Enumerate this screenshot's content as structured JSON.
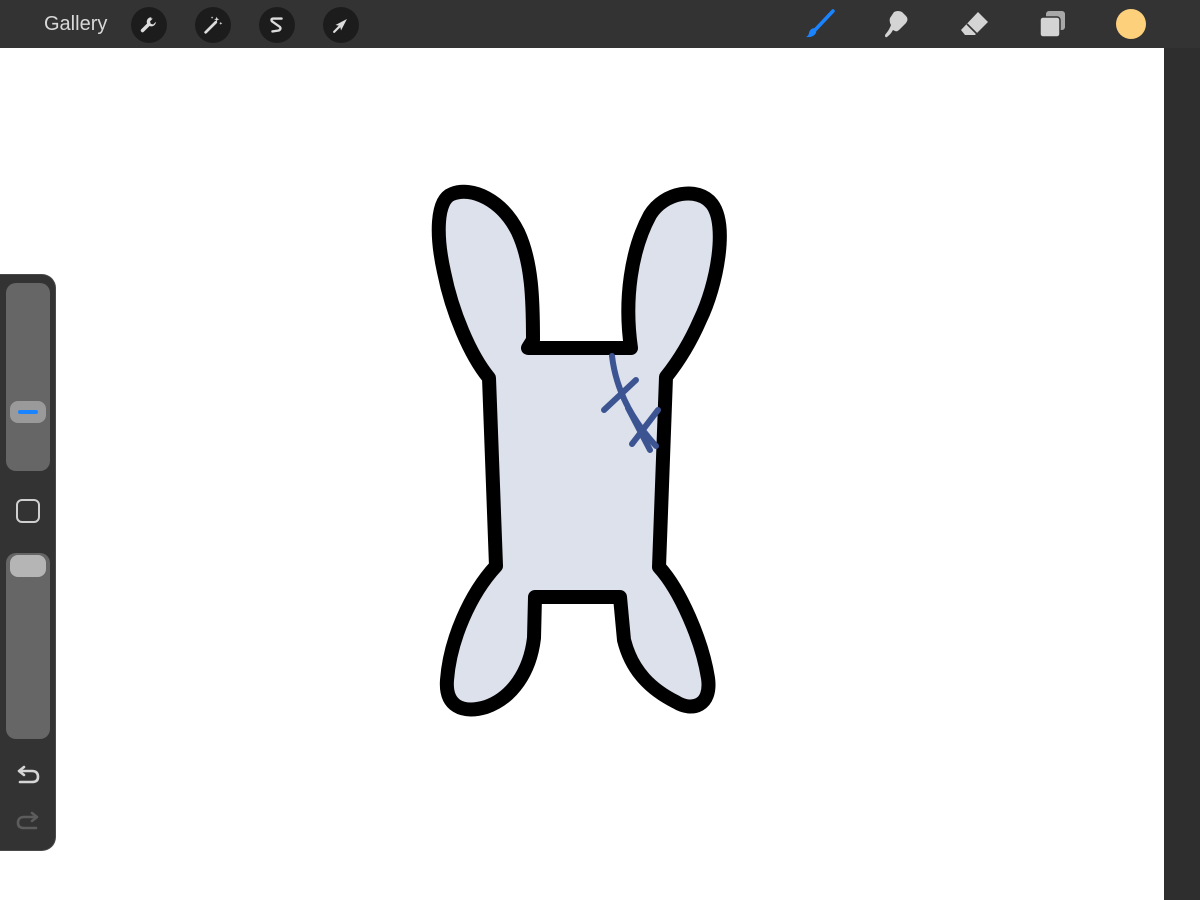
{
  "topbar": {
    "gallery_label": "Gallery",
    "left_tools": [
      {
        "name": "actions",
        "icon": "wrench-icon"
      },
      {
        "name": "adjustments",
        "icon": "magic-wand-icon"
      },
      {
        "name": "selection",
        "icon": "selection-s-icon"
      },
      {
        "name": "transform",
        "icon": "arrow-cursor-icon"
      }
    ],
    "right_tools": [
      {
        "name": "brush",
        "icon": "brush-icon",
        "active": true
      },
      {
        "name": "smudge",
        "icon": "smudge-icon",
        "active": false
      },
      {
        "name": "eraser",
        "icon": "eraser-icon",
        "active": false
      },
      {
        "name": "layers",
        "icon": "layers-icon",
        "active": false
      }
    ],
    "current_color": "#fdd17c"
  },
  "colors": {
    "accent": "#1a84ff",
    "topbar_bg": "#333333",
    "canvas_bg": "#ffffff",
    "drawing_fill": "#dde1ec",
    "drawing_outline": "#000000",
    "ear_fill": "#6a8fea",
    "stitch": "#3c5592"
  },
  "sidebar": {
    "brush_size_icon": "size-slider-icon",
    "opacity_icon": "opacity-slider-icon",
    "modify_icon": "square-modify-icon",
    "undo_icon": "undo-icon",
    "redo_icon": "redo-icon"
  }
}
